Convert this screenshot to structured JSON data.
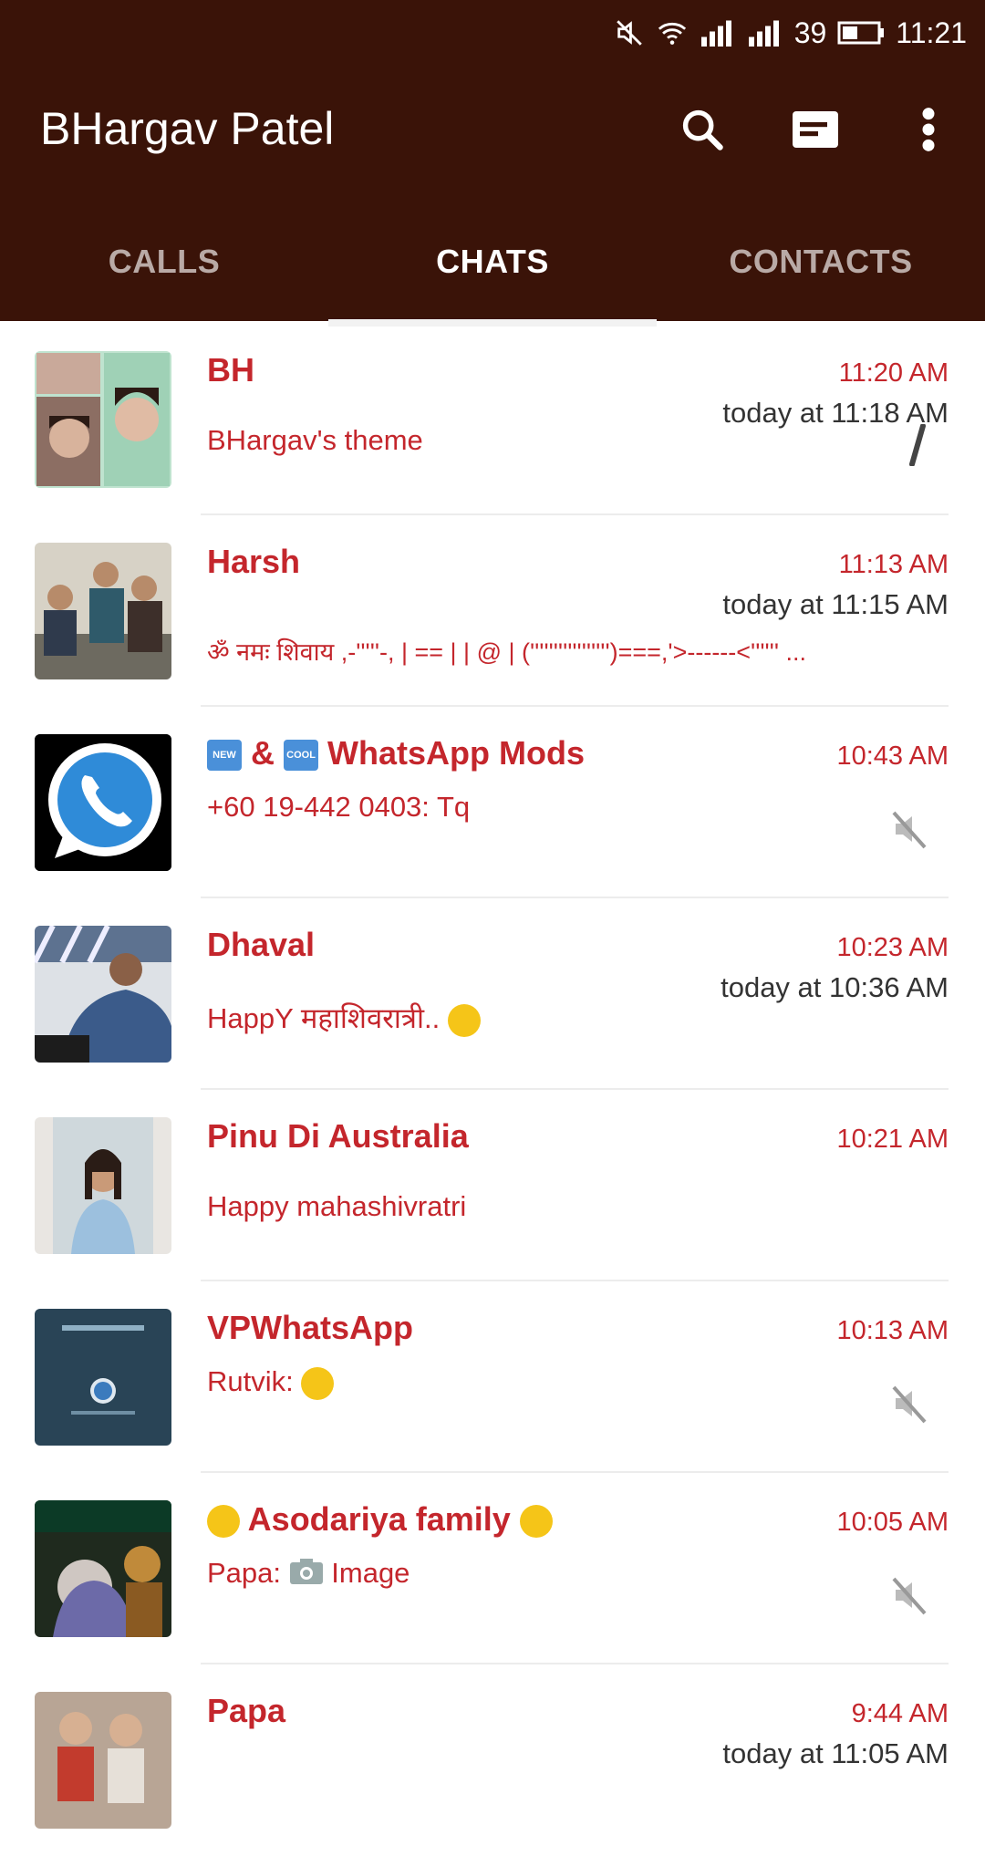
{
  "status_bar": {
    "signal_label": "39",
    "time": "11:21"
  },
  "header": {
    "title": "BHargav Patel"
  },
  "tabs": [
    {
      "label": "CALLS",
      "active": false
    },
    {
      "label": "CHATS",
      "active": true
    },
    {
      "label": "CONTACTS",
      "active": false
    }
  ],
  "colors": {
    "header_bg": "#3a1308",
    "accent_text": "#c4262c"
  },
  "chats": [
    {
      "name": "BH",
      "time": "11:20 AM",
      "sub": "today at 11:18 AM",
      "message": "BHargav's theme",
      "indicator": "pencil"
    },
    {
      "name": "Harsh",
      "time": "11:13 AM",
      "sub": "today at 11:15 AM",
      "message": "ॐ नमः शिवाय ,-'''''-, | == | | @ | (''''''''''''''''')===,'>------<'''''' ..."
    },
    {
      "name_prefix": "NEW",
      "name_mid": "&",
      "name_tag2": "COOL",
      "name": "WhatsApp Mods",
      "time": "10:43 AM",
      "message": "+60 19-442 0403: Tq",
      "indicator": "muted"
    },
    {
      "name": "Dhaval",
      "time": "10:23 AM",
      "sub": "today at 10:36 AM",
      "message": "HappY महाशिवरात्री.."
    },
    {
      "name": "Pinu Di Australia",
      "time": "10:21 AM",
      "message": "Happy mahashivratri"
    },
    {
      "name": "VPWhatsApp",
      "time": "10:13 AM",
      "message": "Rutvik:",
      "indicator": "muted"
    },
    {
      "name": "Asodariya family",
      "time": "10:05 AM",
      "message_prefix": "Papa:",
      "message": "Image",
      "indicator": "muted"
    },
    {
      "name": "Papa",
      "time": "9:44 AM",
      "sub": "today at 11:05 AM"
    }
  ]
}
